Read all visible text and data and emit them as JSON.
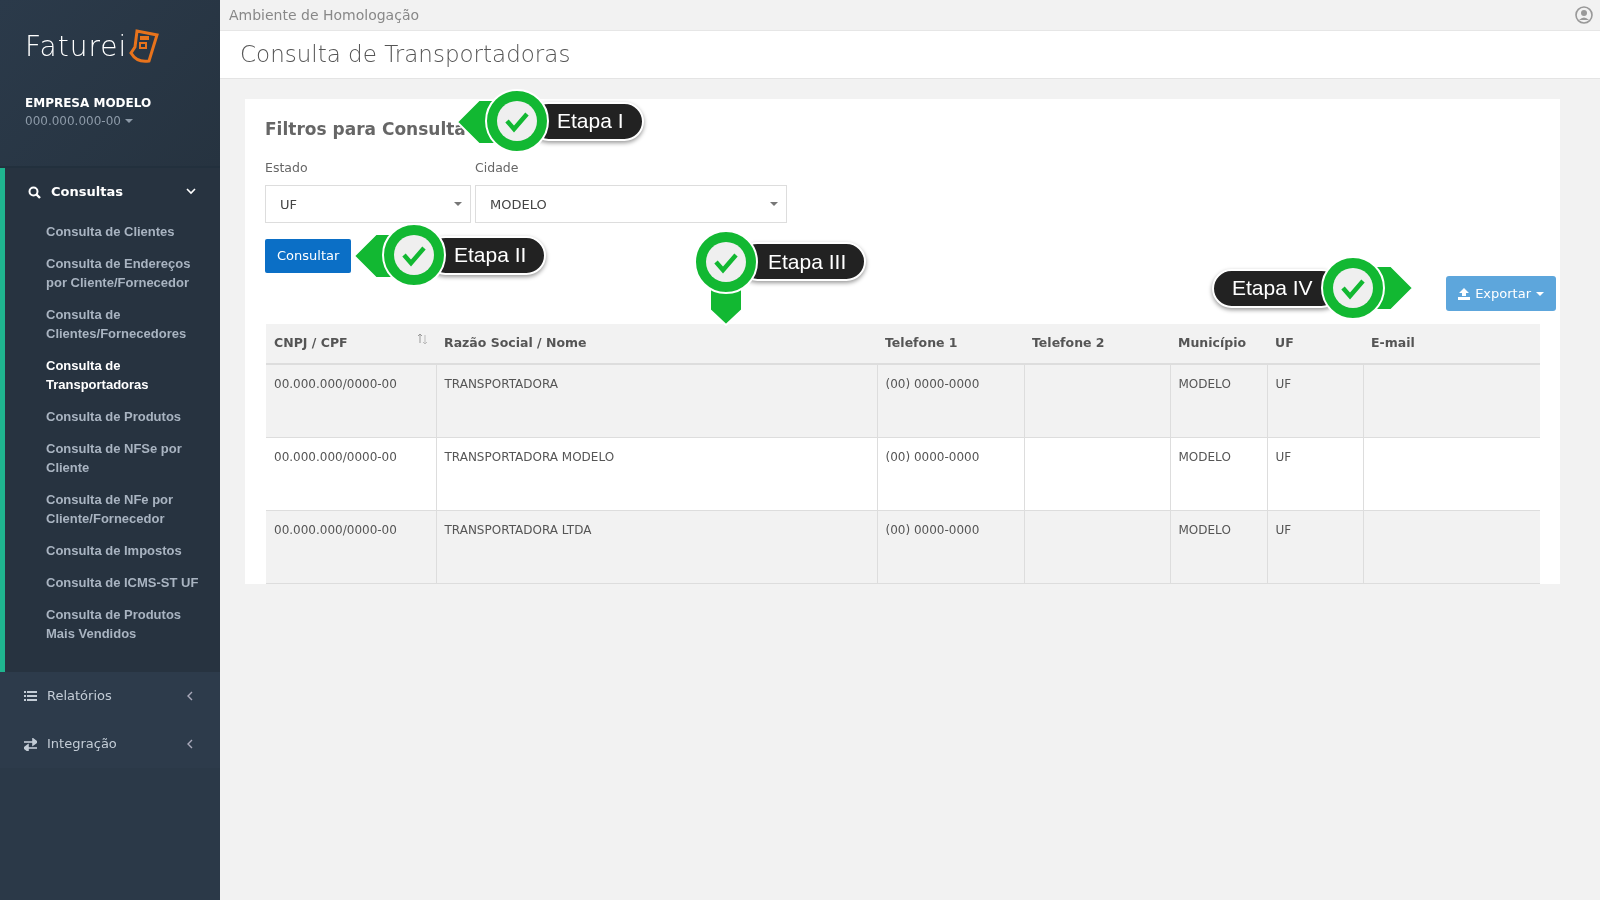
{
  "header": {
    "environment": "Ambiente de Homologação"
  },
  "page_title": "Consulta de Transportadoras",
  "sidebar": {
    "logo": "Faturei",
    "company": "EMPRESA MODELO",
    "company_id": "000.000.000-00",
    "groups": [
      {
        "label": "Consultas",
        "kind": "search",
        "expanded": true,
        "children": [
          {
            "label": "Consulta de Clientes",
            "selected": false
          },
          {
            "label": "Consulta de Endereços por Cliente/Fornecedor",
            "selected": false
          },
          {
            "label": "Consulta de Clientes/Fornecedores",
            "selected": false
          },
          {
            "label": "Consulta de Transportadoras",
            "selected": true
          },
          {
            "label": "Consulta de Produtos",
            "selected": false
          },
          {
            "label": "Consulta de NFSe por Cliente",
            "selected": false
          },
          {
            "label": "Consulta de NFe por Cliente/Fornecedor",
            "selected": false
          },
          {
            "label": "Consulta de Impostos",
            "selected": false
          },
          {
            "label": "Consulta de ICMS-ST UF",
            "selected": false
          },
          {
            "label": "Consulta de Produtos Mais Vendidos",
            "selected": false
          }
        ]
      },
      {
        "label": "Relatórios",
        "kind": "list",
        "expanded": false
      },
      {
        "label": "Integração",
        "kind": "exchange",
        "expanded": false
      }
    ]
  },
  "filters": {
    "title": "Filtros para Consulta",
    "fields": [
      {
        "label": "Estado",
        "value": "UF"
      },
      {
        "label": "Cidade",
        "value": "MODELO"
      }
    ],
    "submit": "Consultar"
  },
  "export_button": "Exportar",
  "table": {
    "columns": [
      {
        "label": "CNPJ / CPF",
        "sortable": true
      },
      {
        "label": "Razão Social / Nome",
        "sortable": false
      },
      {
        "label": "Telefone 1",
        "sortable": false
      },
      {
        "label": "Telefone 2",
        "sortable": false
      },
      {
        "label": "Município",
        "sortable": false
      },
      {
        "label": "UF",
        "sortable": false
      },
      {
        "label": "E-mail",
        "sortable": false
      }
    ],
    "rows": [
      [
        "00.000.000/0000-00",
        "TRANSPORTADORA",
        "(00) 0000-0000",
        "",
        "MODELO",
        "UF",
        ""
      ],
      [
        "00.000.000/0000-00",
        "TRANSPORTADORA MODELO",
        "(00) 0000-0000",
        "",
        "MODELO",
        "UF",
        ""
      ],
      [
        "00.000.000/0000-00",
        "TRANSPORTADORA LTDA",
        "(00) 0000-0000",
        "",
        "MODELO",
        "UF",
        ""
      ]
    ]
  },
  "callouts": [
    {
      "label": "Etapa I",
      "kind": "left"
    },
    {
      "label": "Etapa II",
      "kind": "left"
    },
    {
      "label": "Etapa III",
      "kind": "down"
    },
    {
      "label": "Etapa IV",
      "kind": "right"
    }
  ]
}
